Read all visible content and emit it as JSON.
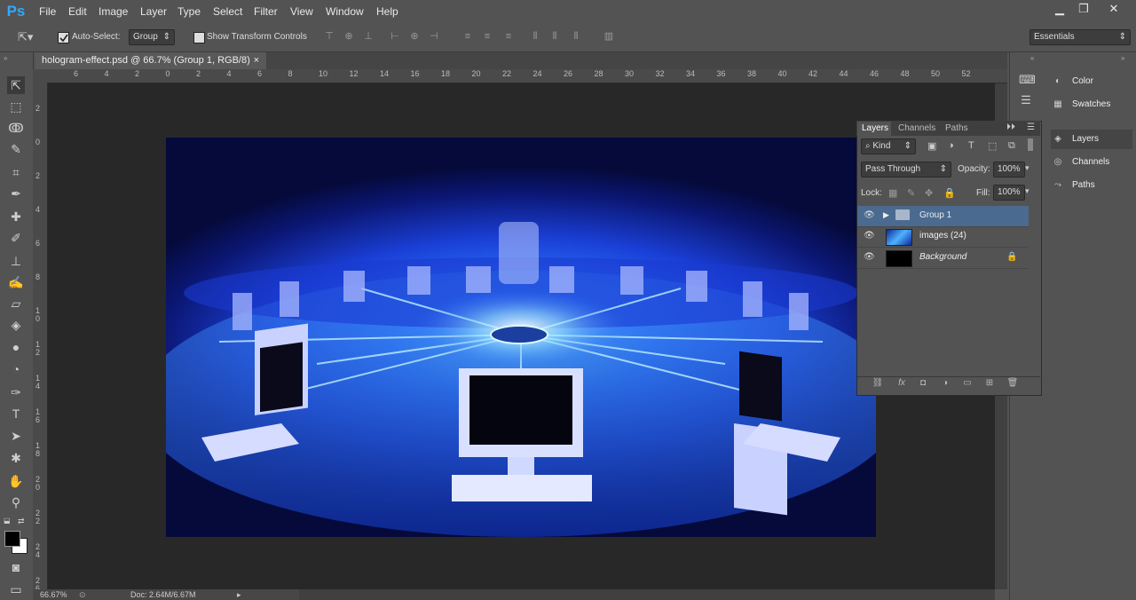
{
  "app": {
    "logo": "Ps"
  },
  "menu": [
    "File",
    "Edit",
    "Image",
    "Layer",
    "Type",
    "Select",
    "Filter",
    "View",
    "Window",
    "Help"
  ],
  "window_controls": {
    "minimize": "▁",
    "restore": "❐",
    "close": "✕"
  },
  "options": {
    "auto_select_label": "Auto-Select:",
    "auto_select_checked": true,
    "auto_select_target": "Group",
    "show_transform_label": "Show Transform Controls",
    "show_transform_checked": false,
    "workspace": "Essentials"
  },
  "document": {
    "tab_title": "hologram-effect.psd @ 66.7% (Group 1, RGB/8)",
    "tab_close": "×"
  },
  "rulers": {
    "top": [
      "6",
      "4",
      "2",
      "0",
      "2",
      "4",
      "6",
      "8",
      "10",
      "12",
      "14",
      "16",
      "18",
      "20",
      "22",
      "24",
      "26",
      "28",
      "30",
      "32",
      "34",
      "36",
      "38",
      "40",
      "42",
      "44",
      "46",
      "48",
      "50",
      "52"
    ],
    "left": [
      "2",
      "0",
      "2",
      "4",
      "6",
      "8",
      "1 0",
      "1 2",
      "1 4",
      "1 6",
      "1 8",
      "2 0",
      "2 2",
      "2 4",
      "2 6"
    ]
  },
  "status": {
    "zoom": "66.67%",
    "doc_size": "Doc: 2.64M/6.67M"
  },
  "dock": [
    {
      "label": "Color",
      "icon": "color-wheel-icon"
    },
    {
      "label": "Swatches",
      "icon": "swatches-icon"
    },
    {
      "label": "Layers",
      "icon": "layers-icon"
    },
    {
      "label": "Channels",
      "icon": "channels-icon"
    },
    {
      "label": "Paths",
      "icon": "paths-icon"
    }
  ],
  "layers_panel": {
    "tabs": [
      "Layers",
      "Channels",
      "Paths"
    ],
    "filter_kind": "Kind",
    "blend_mode": "Pass Through",
    "opacity_label": "Opacity:",
    "opacity_value": "100%",
    "lock_label": "Lock:",
    "fill_label": "Fill:",
    "fill_value": "100%",
    "layers": [
      {
        "name": "Group 1",
        "type": "group",
        "visible": true,
        "selected": true
      },
      {
        "name": "images (24)",
        "type": "image",
        "visible": true,
        "selected": false
      },
      {
        "name": "Background",
        "type": "background",
        "visible": true,
        "locked": true,
        "selected": false
      }
    ]
  },
  "colors": {
    "ui_bg": "#535353",
    "canvas_bg": "#282828",
    "selected_layer": "#4b6a8f",
    "ps_blue": "#31a8ff"
  }
}
